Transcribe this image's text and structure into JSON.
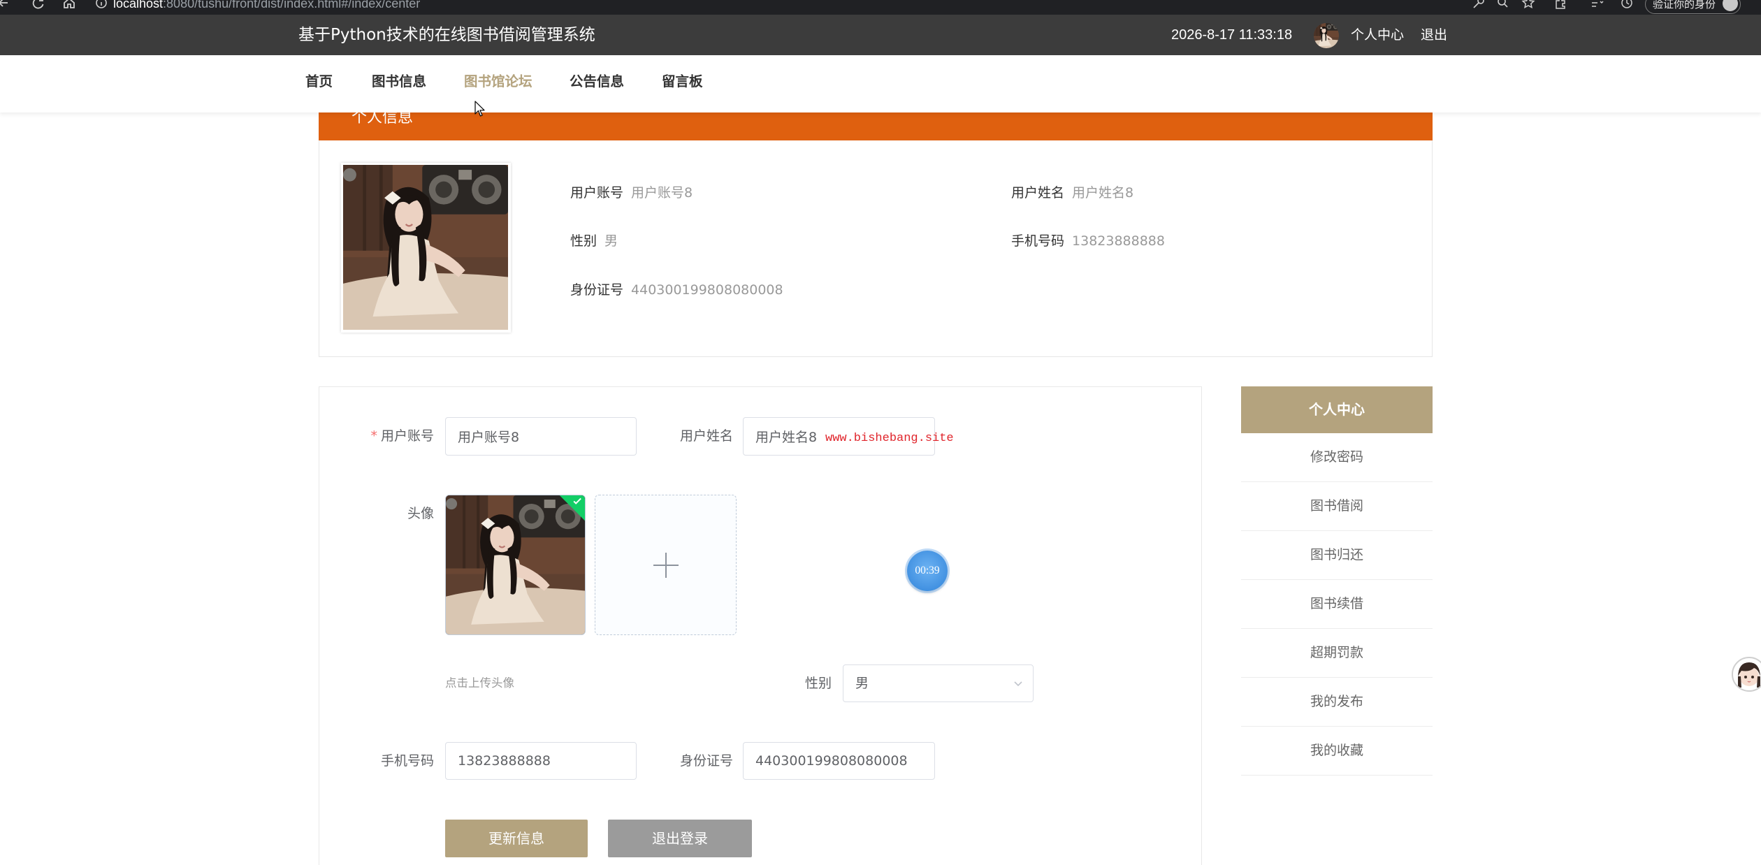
{
  "browser": {
    "url_host": "localhost",
    "url_path": ":8080/tushu/front/dist/index.html#/index/center",
    "profile_label": "验证你的身份"
  },
  "header": {
    "title": "基于Python技术的在线图书借阅管理系统",
    "datetime": "2026-8-17 11:33:18",
    "user_center": "个人中心",
    "logout": "退出"
  },
  "nav": {
    "items": [
      {
        "label": "首页",
        "active": false
      },
      {
        "label": "图书信息",
        "active": false
      },
      {
        "label": "图书馆论坛",
        "active": true
      },
      {
        "label": "公告信息",
        "active": false
      },
      {
        "label": "留言板",
        "active": false
      }
    ]
  },
  "profile": {
    "title": "个人信息",
    "account": {
      "label": "用户账号",
      "value": "用户账号8"
    },
    "name": {
      "label": "用户姓名",
      "value": "用户姓名8"
    },
    "gender": {
      "label": "性别",
      "value": "男"
    },
    "phone": {
      "label": "手机号码",
      "value": "13823888888"
    },
    "id_card": {
      "label": "身份证号",
      "value": "440300199808080008"
    }
  },
  "form": {
    "account": {
      "required_mark": "*",
      "label": "用户账号",
      "value": "用户账号8"
    },
    "name": {
      "label": "用户姓名",
      "value": "用户姓名8"
    },
    "avatar": {
      "label": "头像",
      "hint": "点击上传头像"
    },
    "gender": {
      "label": "性别",
      "value": "男"
    },
    "phone": {
      "label": "手机号码",
      "value": "13823888888"
    },
    "id_card": {
      "label": "身份证号",
      "value": "440300199808080008"
    },
    "update_button": "更新信息",
    "logout_button": "退出登录"
  },
  "sidebar": {
    "title": "个人中心",
    "items": [
      {
        "label": "修改密码"
      },
      {
        "label": "图书借阅"
      },
      {
        "label": "图书归还"
      },
      {
        "label": "图书续借"
      },
      {
        "label": "超期罚款"
      },
      {
        "label": "我的发布"
      },
      {
        "label": "我的收藏"
      }
    ]
  },
  "overlays": {
    "watermark": "www.bishebang.site",
    "timer": "00:39"
  },
  "icons": {
    "browser": [
      "arrow-left-icon",
      "refresh-icon",
      "home-icon",
      "info-icon",
      "key-icon",
      "zoom-icon",
      "star-icon",
      "extensions-icon",
      "favorites-icon",
      "history-icon"
    ],
    "upload_add": "plus-icon",
    "upload_success": "check-icon",
    "select": "chevron-down-icon",
    "cursor": "mouse-cursor-icon"
  },
  "colors": {
    "accent": "#b4a37e",
    "orange": "#df600f",
    "header_bg": "#3c3c3c",
    "gray_button": "#9b9b9b",
    "watermark": "#e0242b",
    "timer": "#3f8fe0"
  }
}
